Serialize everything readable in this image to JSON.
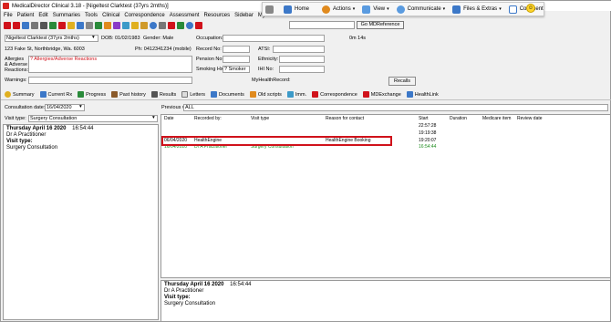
{
  "window": {
    "title": "MedicalDirector Clinical 3.18 - [Nigeltest Clarktest (37yrs 2mths)]"
  },
  "menu": [
    "File",
    "Patient",
    "Edit",
    "Summaries",
    "Tools",
    "Clinical",
    "Correspondence",
    "Assessment",
    "Resources",
    "Sidebar",
    "My"
  ],
  "ribbon": {
    "home": "Home",
    "actions": "Actions",
    "view": "View",
    "communicate": "Communicate",
    "files_extras": "Files & Extras",
    "comment": "Comment"
  },
  "toolbar": {
    "go_md_reference": "Go MDReference"
  },
  "patient": {
    "name_select": "Nigeltest Clarktest (37yrs 2mths)",
    "dob": "DOB: 01/02/1983",
    "gender": "Gender: Male",
    "address": "123 Fake St, Northbridge, Wa. 6003",
    "phone": "Ph: 0412341234 (mobile)",
    "allergies_label": "Allergies & Adverse Reactions:",
    "allergies_value": "? Allergies/Adverse Reactions",
    "warnings_label": "Warnings:",
    "occupation_label": "Occupation:",
    "record_no_label": "Record No:",
    "pension_no_label": "Pension No:",
    "smoking_label": "Smoking Hx:",
    "smoking_value": "? Smoker",
    "atsi_label": "ATSI:",
    "ethnicity_label": "Ethnicity:",
    "ihi_label": "IHI No:",
    "myhealth_label": "MyHealthRecord:",
    "on_time": "0m 14s",
    "recalls_button": "Recalls"
  },
  "tabs": [
    "Summary",
    "Current Rx",
    "Progress",
    "Past history",
    "Results",
    "Letters",
    "Documents",
    "Old scripts",
    "Imm.",
    "Correspondence",
    "MDExchange",
    "HealthLink"
  ],
  "consultation": {
    "date_label": "Consultation date:",
    "date_value": "16/04/2020",
    "visit_type_label": "Visit type:",
    "visit_type_value": "Surgery Consultation",
    "previous_visits_label": "Previous visits:",
    "previous_visits_value": "ALL"
  },
  "left_note": {
    "heading_date": "Thursday April 16 2020",
    "heading_time": "16:54:44",
    "doctor": "Dr A Practitioner",
    "visit_type_label": "Visit type:",
    "visit_type_value": "Surgery Consultation"
  },
  "visits_table": {
    "columns": [
      "Date",
      "Recorded by:",
      "Visit type",
      "Reason for contact",
      "Start",
      "Duration",
      "Medicare item",
      "Review date"
    ],
    "rows": [
      {
        "date": "",
        "recorded_by": "",
        "visit_type": "",
        "reason": "",
        "start": "22:57:28",
        "color": "#000000"
      },
      {
        "date": "",
        "recorded_by": "",
        "visit_type": "",
        "reason": "",
        "start": "19:19:38",
        "color": "#000000"
      },
      {
        "date": "06/04/2020",
        "recorded_by": "HealthEngine",
        "visit_type": "",
        "reason": "HealthEngine Booking",
        "start": "19:20:07",
        "color": "#000000"
      },
      {
        "date": "16/04/2020",
        "recorded_by": "Dr A Practitioner",
        "visit_type": "Surgery Consultation",
        "reason": "",
        "start": "16:54:44",
        "color": "#1e8c1e"
      }
    ]
  },
  "bottom_note": {
    "heading_date": "Thursday April 16 2020",
    "heading_time": "16:54:44",
    "doctor": "Dr A Practitioner",
    "visit_type_label": "Visit type:",
    "visit_type_value": "Surgery Consultation"
  },
  "colors": {
    "highlight": "#d0121b",
    "allergy_text": "#d0121b",
    "current_row": "#1e8c1e"
  }
}
